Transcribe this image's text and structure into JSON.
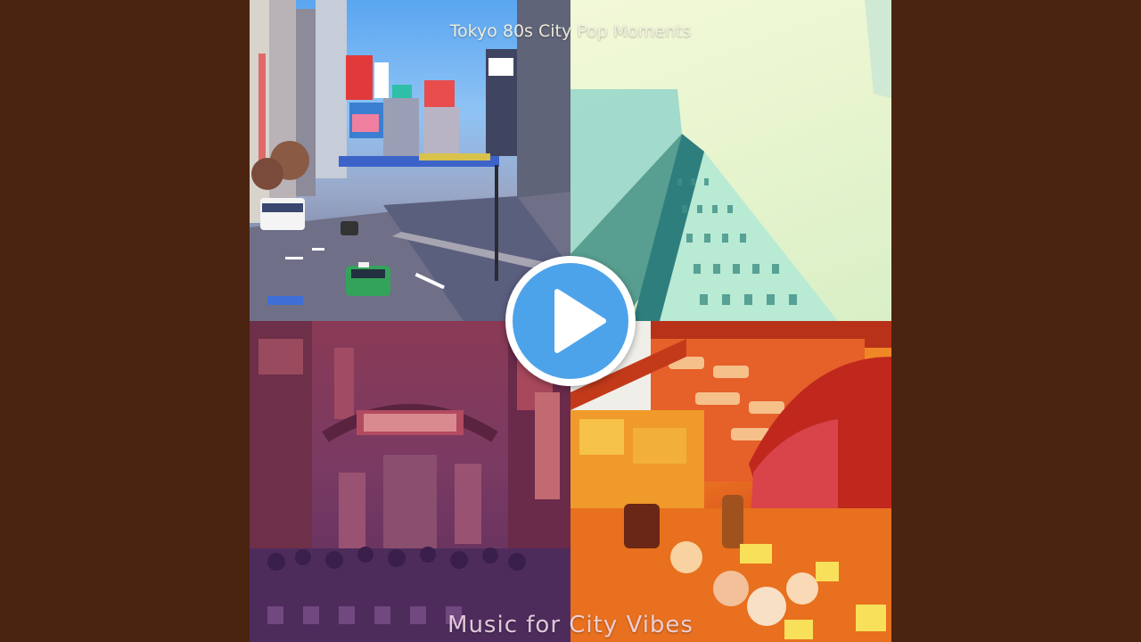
{
  "video": {
    "title_top": "Tokyo 80s City Pop Moments",
    "title_bottom": "Music for City Vibes"
  },
  "play_button": {
    "icon": "play-icon",
    "outer_color": "#ffffff",
    "inner_color": "#4da3ea"
  },
  "background_color": "#4a2410"
}
